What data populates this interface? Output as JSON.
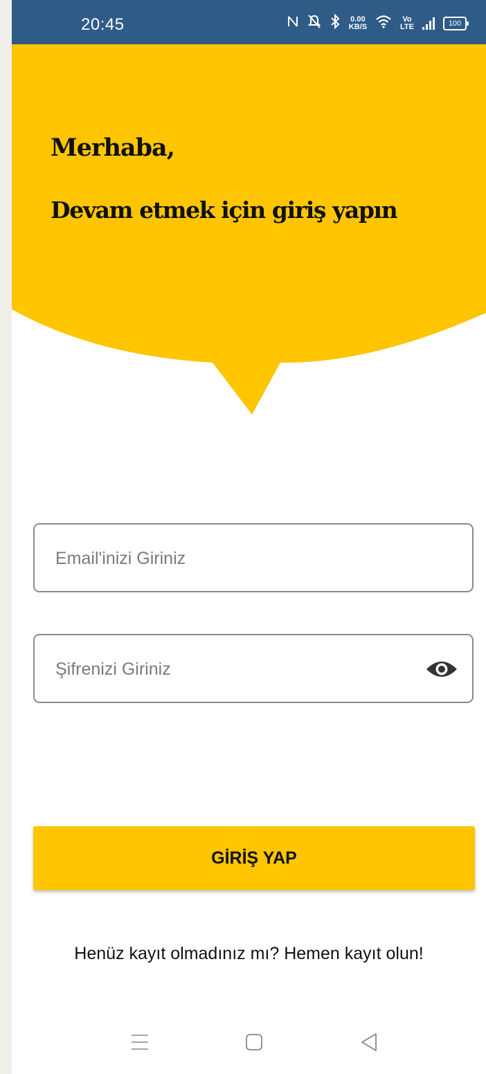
{
  "status_bar": {
    "time": "20:45",
    "net_speed_value": "0.00",
    "net_speed_unit": "KB/S",
    "volte_top": "Vo",
    "volte_bottom": "LTE",
    "battery": "100"
  },
  "header": {
    "greeting": "Merhaba,",
    "subtitle": "Devam etmek için giriş yapın"
  },
  "form": {
    "email_placeholder": "Email'inizi Giriniz",
    "password_placeholder": "Şifrenizi Giriniz",
    "login_button": "GİRİŞ YAP",
    "register_prompt": "Henüz kayıt olmadınız mı? Hemen kayıt olun!"
  },
  "colors": {
    "accent": "#fec500",
    "status_bar": "#2f5b87",
    "text": "#111111"
  },
  "icons": {
    "password_toggle": "eye-icon",
    "nav_menu": "menu-icon",
    "nav_home": "home-icon",
    "nav_back": "back-icon"
  }
}
